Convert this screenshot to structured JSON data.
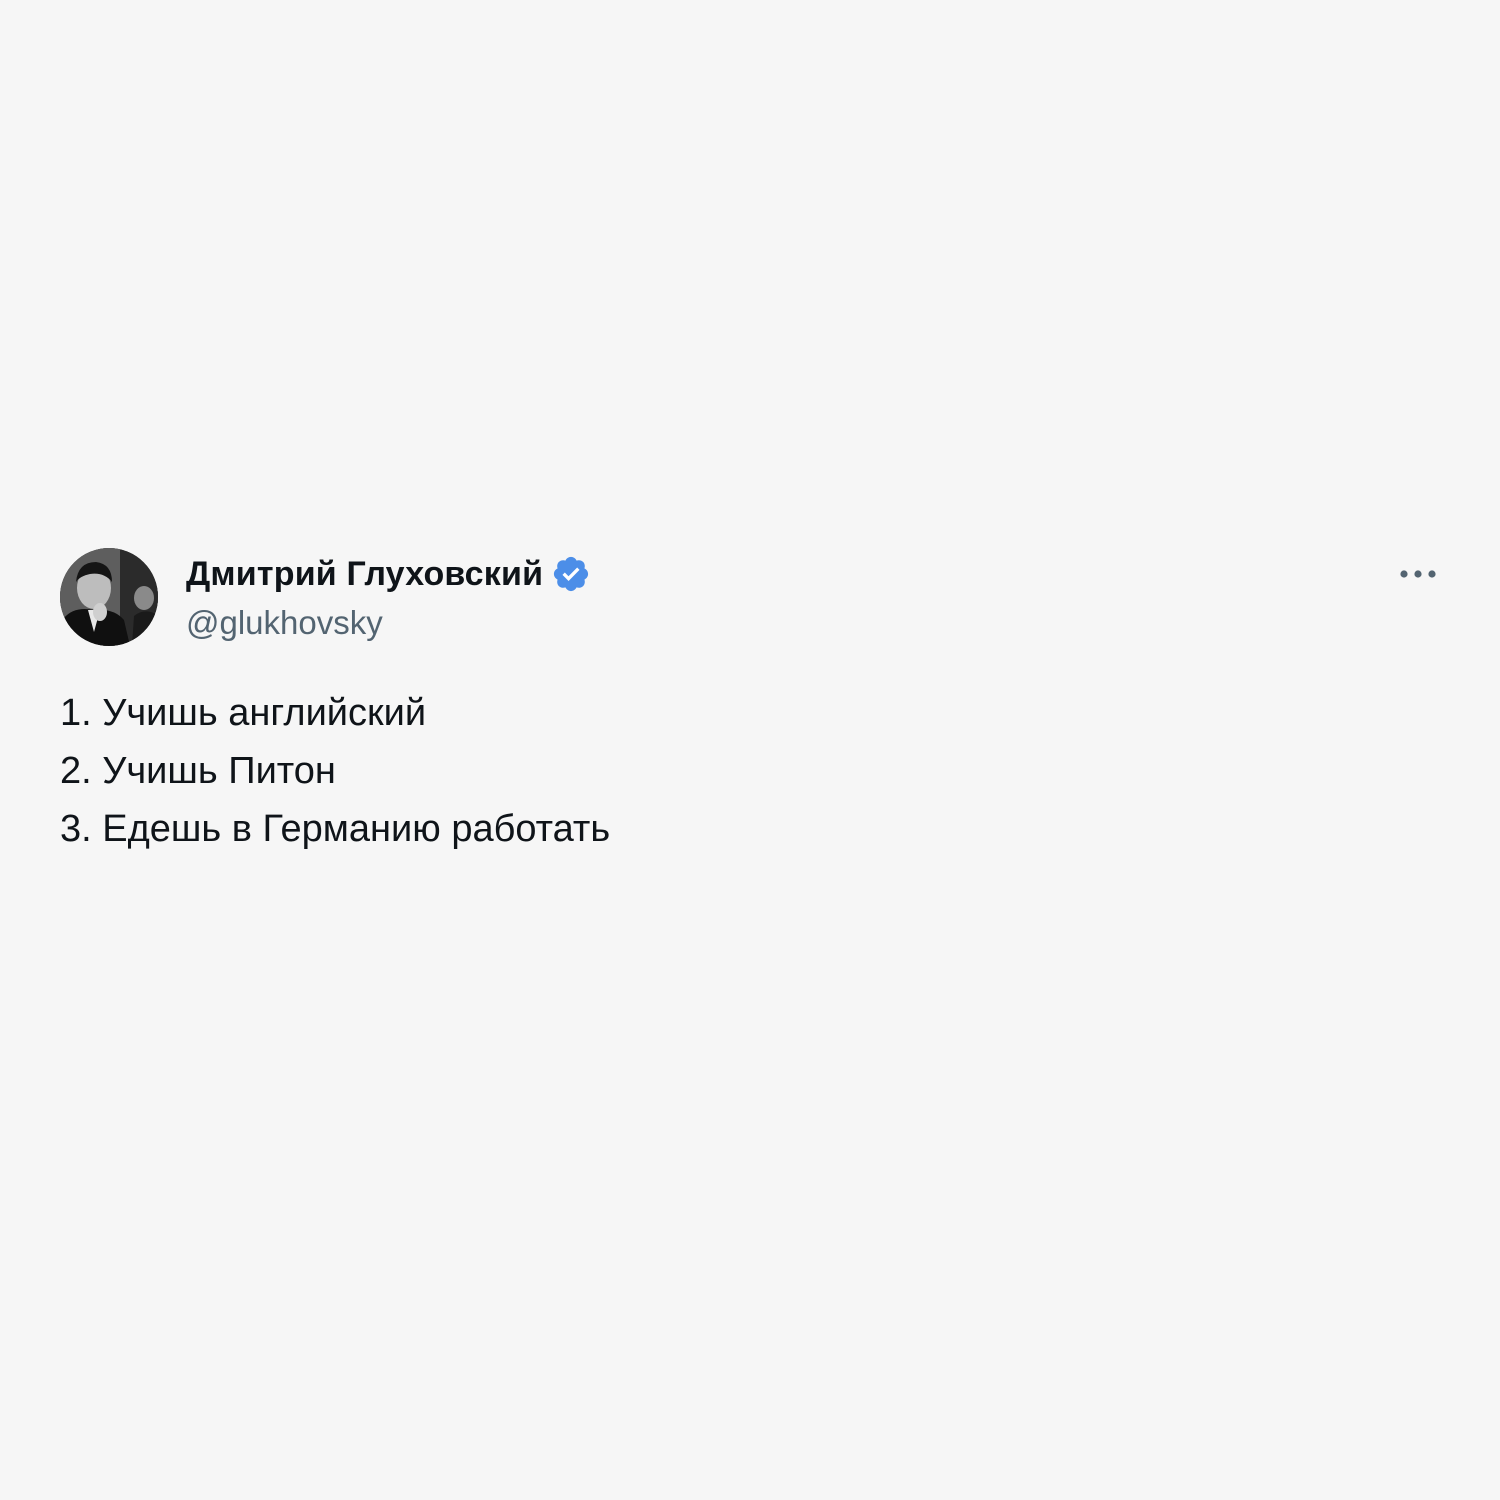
{
  "tweet": {
    "author": {
      "display_name": "Дмитрий Глуховский",
      "handle": "@glukhovsky",
      "verified": true,
      "avatar_icon": "profile-photo"
    },
    "more_icon": "more-dots-icon",
    "text_lines": [
      "1. Учишь английский",
      "2. Учишь Питон",
      "3. Едешь в Германию работать"
    ]
  },
  "colors": {
    "background": "#f6f6f6",
    "text": "#0f1419",
    "handle": "#536471",
    "verified": "#4c8ee8"
  }
}
